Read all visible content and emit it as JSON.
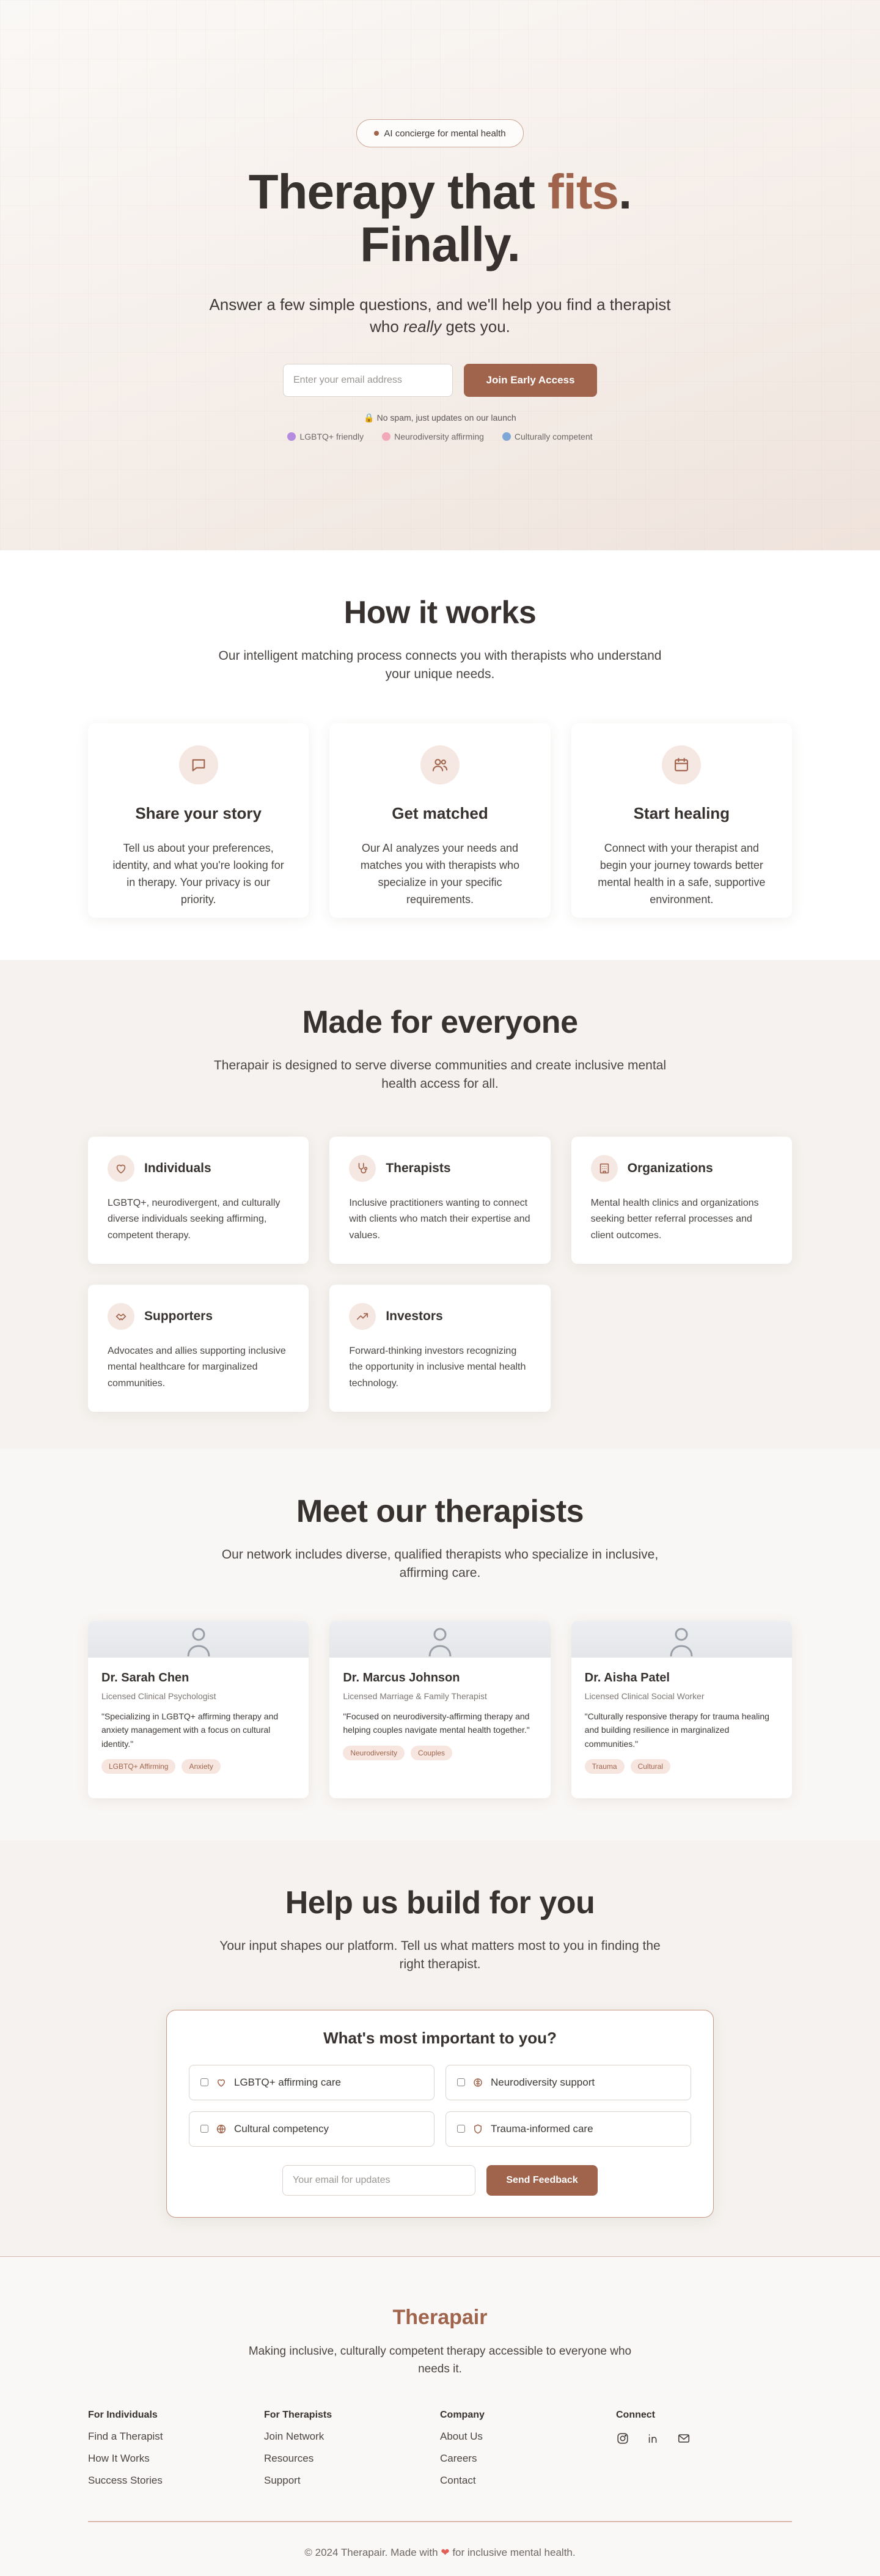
{
  "hero": {
    "badge": "AI concierge for mental health",
    "title_part1": "Therapy that ",
    "title_accent": "fits",
    "title_period": ".",
    "title_line2": "Finally.",
    "subtitle_pre": "Answer a few simple questions, and we'll help you find a therapist who ",
    "subtitle_em": "really",
    "subtitle_post": " gets you.",
    "email_placeholder": "Enter your email address",
    "cta": "Join Early Access",
    "nospam": "No spam, just updates on our launch",
    "chips": [
      "LGBTQ+ friendly",
      "Neurodiversity affirming",
      "Culturally competent"
    ]
  },
  "how": {
    "title": "How it works",
    "lede": "Our intelligent matching process connects you with therapists who understand your unique needs.",
    "cards": [
      {
        "icon": "chat-icon",
        "title": "Share your story",
        "text": "Tell us about your preferences, identity, and what you're looking for in therapy. Your privacy is our priority."
      },
      {
        "icon": "users-icon",
        "title": "Get matched",
        "text": "Our AI analyzes your needs and matches you with therapists who specialize in your specific requirements."
      },
      {
        "icon": "calendar-icon",
        "title": "Start healing",
        "text": "Connect with your therapist and begin your journey towards better mental health in a safe, supportive environment."
      }
    ]
  },
  "everyone": {
    "title": "Made for everyone",
    "lede": "Therapair is designed to serve diverse communities and create inclusive mental health access for all.",
    "cards": [
      {
        "icon": "heart-icon",
        "title": "Individuals",
        "text": "LGBTQ+, neurodivergent, and culturally diverse individuals seeking affirming, competent therapy."
      },
      {
        "icon": "stethoscope-icon",
        "title": "Therapists",
        "text": "Inclusive practitioners wanting to connect with clients who match their expertise and values."
      },
      {
        "icon": "building-icon",
        "title": "Organizations",
        "text": "Mental health clinics and organizations seeking better referral processes and client outcomes."
      },
      {
        "icon": "handshake-icon",
        "title": "Supporters",
        "text": "Advocates and allies supporting inclusive mental healthcare for marginalized communities."
      },
      {
        "icon": "trending-up-icon",
        "title": "Investors",
        "text": "Forward-thinking investors recognizing the opportunity in inclusive mental health technology."
      }
    ]
  },
  "therapists": {
    "title": "Meet our therapists",
    "lede": "Our network includes diverse, qualified therapists who specialize in inclusive, affirming care.",
    "cards": [
      {
        "name": "Dr. Sarah Chen",
        "role": "Licensed Clinical Psychologist",
        "quote": "\"Specializing in LGBTQ+ affirming therapy and anxiety management with a focus on cultural identity.\"",
        "tags": [
          "LGBTQ+ Affirming",
          "Anxiety"
        ]
      },
      {
        "name": "Dr. Marcus Johnson",
        "role": "Licensed Marriage & Family Therapist",
        "quote": "\"Focused on neurodiversity-affirming therapy and helping couples navigate mental health together.\"",
        "tags": [
          "Neurodiversity",
          "Couples"
        ]
      },
      {
        "name": "Dr. Aisha Patel",
        "role": "Licensed Clinical Social Worker",
        "quote": "\"Culturally responsive therapy for trauma healing and building resilience in marginalized communities.\"",
        "tags": [
          "Trauma",
          "Cultural"
        ]
      }
    ]
  },
  "build": {
    "title": "Help us build for you",
    "lede": "Your input shapes our platform. Tell us what matters most to you in finding the right therapist.",
    "question": "What's most important to you?",
    "options": [
      {
        "icon": "heart-icon",
        "label": "LGBTQ+ affirming care"
      },
      {
        "icon": "brain-icon",
        "label": "Neurodiversity support"
      },
      {
        "icon": "globe-icon",
        "label": "Cultural competency"
      },
      {
        "icon": "shield-icon",
        "label": "Trauma-informed care"
      }
    ],
    "email_placeholder": "Your email for updates",
    "cta": "Send Feedback"
  },
  "footer": {
    "brand": "Therapair",
    "tagline": "Making inclusive, culturally competent therapy accessible to everyone who needs it.",
    "columns": [
      {
        "title": "For Individuals",
        "links": [
          "Find a Therapist",
          "How It Works",
          "Success Stories"
        ]
      },
      {
        "title": "For Therapists",
        "links": [
          "Join Network",
          "Resources",
          "Support"
        ]
      },
      {
        "title": "Company",
        "links": [
          "About Us",
          "Careers",
          "Contact"
        ]
      }
    ],
    "connect_title": "Connect",
    "copyright_pre": "© 2024 Therapair. Made with",
    "copyright_post": "for inclusive mental health."
  },
  "colors": {
    "accent": "#a0644c",
    "accent_light": "#f5e7e1",
    "text_dark": "#37322f"
  }
}
